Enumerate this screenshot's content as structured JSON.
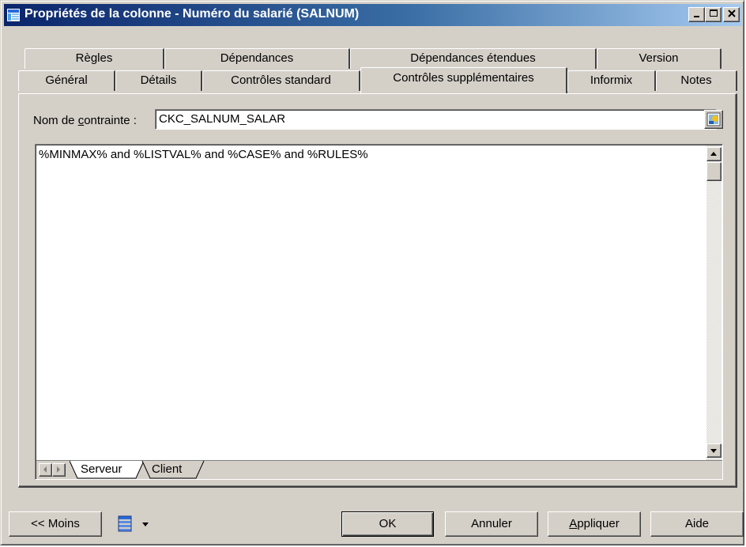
{
  "window": {
    "title": "Propriétés de la colonne - Numéro du salarié (SALNUM)",
    "controls": {
      "minimize": "_",
      "maximize": "□",
      "close": "×"
    }
  },
  "tabs": {
    "row1": [
      "Règles",
      "Dépendances",
      "Dépendances étendues",
      "Version"
    ],
    "row2": [
      "Général",
      "Détails",
      "Contrôles standard",
      "Contrôles supplémentaires",
      "Informix",
      "Notes"
    ],
    "active": "Contrôles supplémentaires"
  },
  "constraint": {
    "label_prefix": "Nom de ",
    "label_accel": "c",
    "label_suffix": "ontrainte :",
    "value": "CKC_SALNUM_SALAR"
  },
  "editor": {
    "text": "%MINMAX% and %LISTVAL% and %CASE% and %RULES%",
    "subtabs": [
      "Serveur",
      "Client"
    ],
    "active_subtab": "Serveur"
  },
  "buttons": {
    "less": "<< Moins",
    "ok": "OK",
    "cancel": "Annuler",
    "apply_accel": "A",
    "apply_rest": "ppliquer",
    "help": "Aide"
  },
  "colors": {
    "title_start": "#0a246a",
    "title_end": "#a6caf0",
    "face": "#d4d0c8"
  },
  "icons": [
    "columns-icon",
    "properties-icon",
    "menu-icon",
    "dropdown-arrow-icon",
    "scroll-up-icon",
    "scroll-down-icon",
    "tab-left-icon",
    "tab-right-icon"
  ]
}
